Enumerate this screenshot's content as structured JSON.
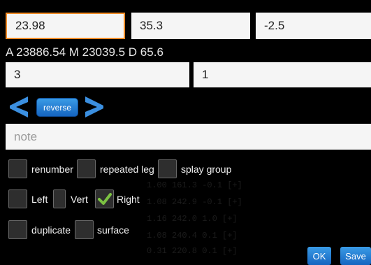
{
  "fields": {
    "length": "23.98",
    "azimuth": "35.3",
    "clino": "-2.5",
    "from_station": "3",
    "to_station": "1",
    "note_placeholder": "note"
  },
  "stats": {
    "line": "A 23886.54  M 23039.5  D 65.6"
  },
  "nav": {
    "reverse_label": "reverse",
    "prev_icon": "chevron-left-icon",
    "next_icon": "chevron-right-icon"
  },
  "checkboxes": {
    "renumber": {
      "label": "renumber",
      "checked": false
    },
    "repeated_leg": {
      "label": "repeated leg",
      "checked": false
    },
    "splay_group": {
      "label": "splay group",
      "checked": false
    },
    "left": {
      "label": "Left",
      "checked": false
    },
    "vert": {
      "label": "Vert",
      "checked": false
    },
    "right": {
      "label": "Right",
      "checked": true
    },
    "duplicate": {
      "label": "duplicate",
      "checked": false
    },
    "surface": {
      "label": "surface",
      "checked": false
    }
  },
  "buttons": {
    "ok": "OK",
    "save": "Save"
  },
  "colors": {
    "accent": "#1e88e5",
    "focus_border": "#f28c28",
    "check": "#7cc242",
    "background": "#000000"
  }
}
